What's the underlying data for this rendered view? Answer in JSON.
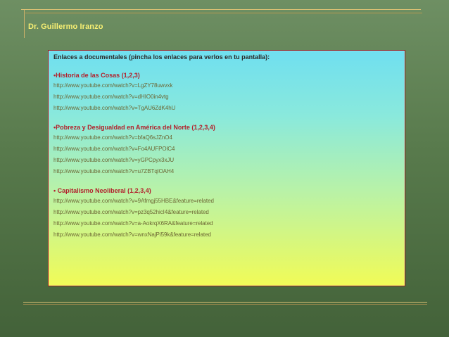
{
  "header": {
    "author": "Dr. Guillermo Iranzo"
  },
  "slide": {
    "intro": "Enlaces a documentales (pincha los enlaces para  verlos en tu pantalla):",
    "sections": [
      {
        "title": "•Historia de las Cosas (1,2,3)",
        "links": [
          "http://www.youtube.com/watch?v=LgZY78uwvxk",
          "http://www.youtube.com/watch?v=dHIO0in4vtg",
          "http://www.youtube.com/watch?v=TgAU6ZdK4hU"
        ]
      },
      {
        "title": "•Pobreza y Desigualdad en América del Norte (1,2,3,4)",
        "links": [
          "http://www.youtube.com/watch?v=bfaQ6sJZnO4",
          "http://www.youtube.com/watch?v=Fo4AUFPOlC4",
          "http://www.youtube.com/watch?v=yGPCpyx3xJU",
          "http://www.youtube.com/watch?v=u7ZBTqlOAH4"
        ]
      },
      {
        "title": "• Capitalismo Neoliberal (1,2,3,4)",
        "links": [
          "http://www.youtube.com/watch?v=9Afmgj55HBE&feature=related",
          "http://www.youtube.com/watch?v=pz3q52hicI4&feature=related",
          "http://www.youtube.com/watch?v=a-AokrqX6RA&feature=related",
          "http://www.youtube.com/watch?v=wnxNajPi59k&feature=related"
        ]
      }
    ]
  }
}
